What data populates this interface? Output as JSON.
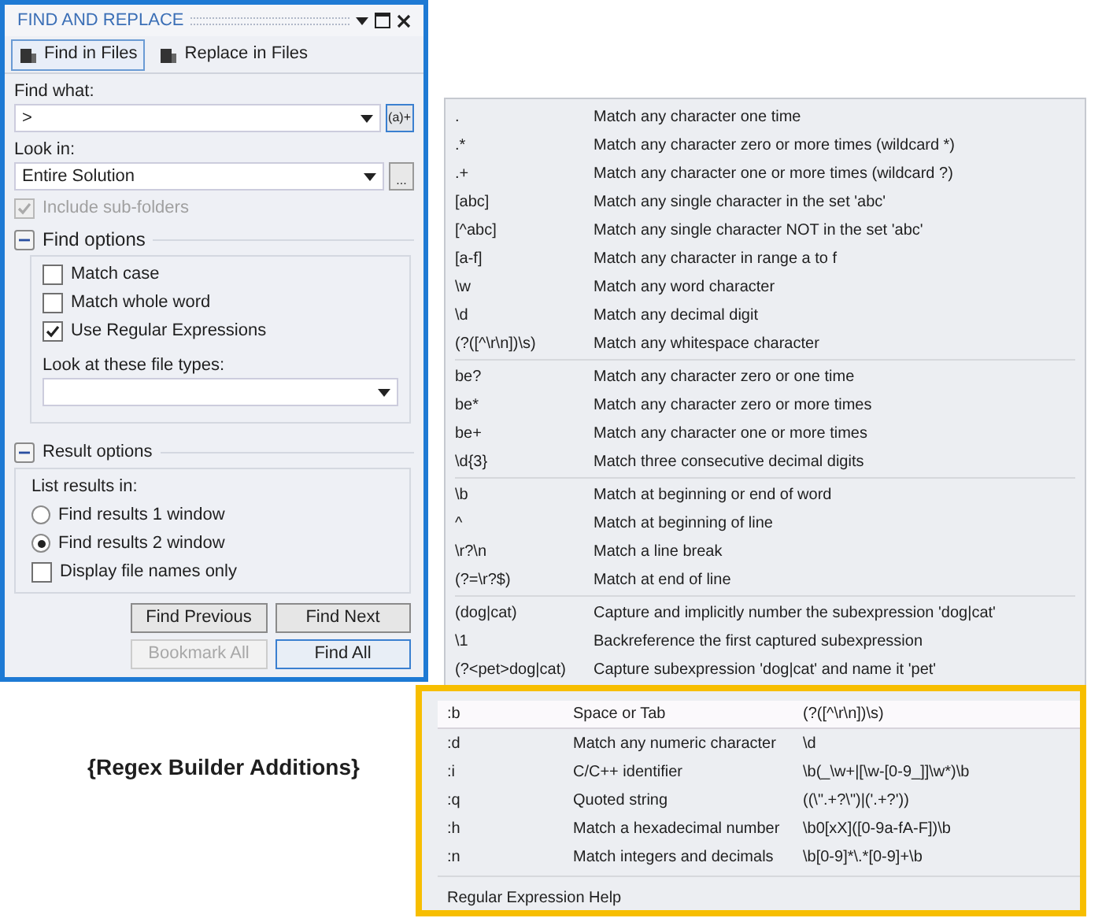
{
  "window": {
    "title": "FIND AND REPLACE"
  },
  "tabs": [
    {
      "label": "Find in Files",
      "selected": true
    },
    {
      "label": "Replace in Files",
      "selected": false
    }
  ],
  "find_what": {
    "label": "Find what:",
    "value": ">",
    "regex_button": "(a)+"
  },
  "look_in": {
    "label": "Look in:",
    "value": "Entire Solution",
    "browse_button": "..."
  },
  "include_subfolders": {
    "label": "Include sub-folders",
    "checked": true,
    "disabled": true
  },
  "find_options": {
    "title": "Find options",
    "expanded": true,
    "options": [
      {
        "label": "Match case",
        "checked": false
      },
      {
        "label": "Match whole word",
        "checked": false
      },
      {
        "label": "Use Regular Expressions",
        "checked": true
      }
    ],
    "file_types": {
      "label": "Look at these file types:"
    }
  },
  "result_options": {
    "title": "Result options",
    "expanded": true,
    "list_label": "List results in:",
    "radios": [
      {
        "label": "Find results 1 window",
        "selected": false
      },
      {
        "label": "Find results 2 window",
        "selected": true
      }
    ],
    "display_file_names_only": {
      "label": "Display file names only",
      "checked": false
    }
  },
  "buttons": [
    {
      "label": "Find Previous",
      "disabled": false,
      "default": false
    },
    {
      "label": "Find Next",
      "disabled": false,
      "default": false
    },
    {
      "label": "Bookmark All",
      "disabled": true,
      "default": false
    },
    {
      "label": "Find All",
      "disabled": false,
      "default": true
    }
  ],
  "heading": "{Regex Builder Additions}",
  "regex_menu": {
    "groups": [
      [
        {
          "expr": ".",
          "desc": "Match any character one time"
        },
        {
          "expr": ".*",
          "desc": "Match any character zero or more times (wildcard *)"
        },
        {
          "expr": ".+",
          "desc": "Match any character one or more times (wildcard ?)"
        },
        {
          "expr": "[abc]",
          "desc": "Match any single character in the set 'abc'"
        },
        {
          "expr": "[^abc]",
          "desc": "Match any single character NOT in the set 'abc'"
        },
        {
          "expr": "[a-f]",
          "desc": "Match any character in range a to f"
        },
        {
          "expr": "\\w",
          "desc": "Match any word character"
        },
        {
          "expr": "\\d",
          "desc": "Match any decimal digit"
        },
        {
          "expr": "(?([^\\r\\n])\\s)",
          "desc": "Match any whitespace character"
        }
      ],
      [
        {
          "expr": "be?",
          "desc": "Match any character zero or one time"
        },
        {
          "expr": "be*",
          "desc": "Match any character zero or more times"
        },
        {
          "expr": "be+",
          "desc": "Match any character one or more times"
        },
        {
          "expr": "\\d{3}",
          "desc": "Match three consecutive decimal digits"
        }
      ],
      [
        {
          "expr": "\\b",
          "desc": "Match at beginning or end of word"
        },
        {
          "expr": "^",
          "desc": "Match at beginning of line"
        },
        {
          "expr": "\\r?\\n",
          "desc": "Match a line break"
        },
        {
          "expr": "(?=\\r?$)",
          "desc": "Match at end of line"
        }
      ],
      [
        {
          "expr": "(dog|cat)",
          "desc": "Capture and implicitly number the subexpression 'dog|cat'"
        },
        {
          "expr": "\\1",
          "desc": "Backreference the first captured subexpression"
        },
        {
          "expr": "(?<pet>dog|cat)",
          "desc": "Capture subexpression 'dog|cat' and name it 'pet'"
        }
      ]
    ],
    "additions": [
      {
        "code": ":b",
        "desc": "Space or Tab",
        "expr": "(?([^\\r\\n])\\s)",
        "highlighted": true
      },
      {
        "code": ":d",
        "desc": "Match any numeric character",
        "expr": "\\d",
        "highlighted": false
      },
      {
        "code": ":i",
        "desc": "C/C++ identifier",
        "expr": "\\b(_\\w+|[\\w-[0-9_]]\\w*)\\b",
        "highlighted": false
      },
      {
        "code": ":q",
        "desc": "Quoted string",
        "expr": "((\\\".+?\\\")|('.+?'))",
        "highlighted": false
      },
      {
        "code": ":h",
        "desc": "Match a hexadecimal number",
        "expr": "\\b0[xX]([0-9a-fA-F])\\b",
        "highlighted": false
      },
      {
        "code": ":n",
        "desc": "Match integers and decimals",
        "expr": "\\b[0-9]*\\.*[0-9]+\\b",
        "highlighted": false
      }
    ],
    "help": "Regular Expression Help"
  }
}
